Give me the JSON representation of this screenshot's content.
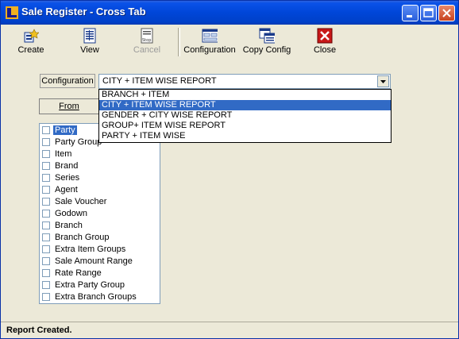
{
  "window": {
    "title": "Sale Register - Cross Tab"
  },
  "toolbar": {
    "create": "Create",
    "view": "View",
    "cancel": "Cancel",
    "configuration": "Configuration",
    "copy_config": "Copy Config",
    "close": "Close"
  },
  "config": {
    "label": "Configuration",
    "selected": "CITY + ITEM WISE REPORT",
    "options": [
      "BRANCH + ITEM",
      "CITY + ITEM WISE REPORT",
      "GENDER + CITY WISE REPORT",
      "GROUP+ ITEM WISE REPORT",
      "PARTY + ITEM WISE"
    ]
  },
  "from_button": "From",
  "fields": [
    "Party",
    "Party Group",
    "Item",
    "Brand",
    "Series",
    "Agent",
    "Sale Voucher",
    "Godown",
    "Branch",
    "Branch Group",
    "Extra Item Groups",
    "Sale Amount Range",
    "Rate Range",
    "Extra Party Group",
    "Extra Branch Groups"
  ],
  "status": "Report Created."
}
